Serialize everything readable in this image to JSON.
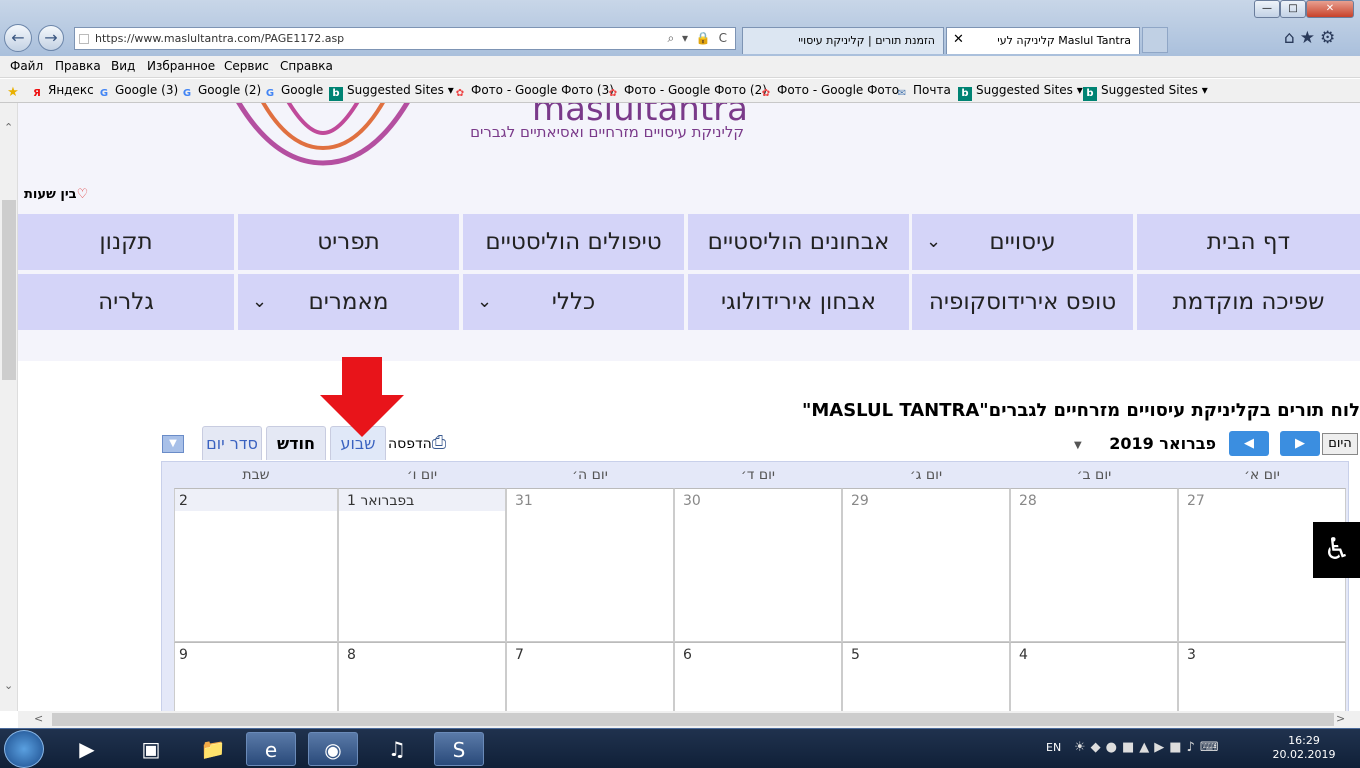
{
  "window": {
    "controls": {
      "minimize": "—",
      "maximize": "□",
      "close": "✕"
    },
    "tabs": [
      {
        "label": "הזמנת תורים | קליניקת עיסויי"
      },
      {
        "label": "Maslul Tantra קליניקה לעי",
        "close": "✕"
      }
    ],
    "toolbar_icons": [
      "home-icon",
      "star-icon",
      "gear-icon"
    ]
  },
  "address_bar": {
    "url": "https://www.maslultantra.com/PAGE1172.asp",
    "controls": "⌕ ▾ 🔒 C"
  },
  "menu": [
    "Файл",
    "Правка",
    "Вид",
    "Избранное",
    "Сервис",
    "Справка"
  ],
  "favorites": [
    {
      "label": "Яндекс",
      "icon": "Я",
      "kind": "y"
    },
    {
      "label": "Google (3)",
      "icon": "G",
      "kind": "g"
    },
    {
      "label": "Google (2)",
      "icon": "G",
      "kind": "g"
    },
    {
      "label": "Google",
      "icon": "G",
      "kind": "g"
    },
    {
      "label": "Suggested Sites ▾",
      "icon": "b",
      "kind": "b"
    },
    {
      "label": "Фото - Google Фото (3)",
      "icon": "✿",
      "kind": "p"
    },
    {
      "label": "Фото - Google Фото (2)",
      "icon": "✿",
      "kind": "p"
    },
    {
      "label": "Фото - Google Фото",
      "icon": "✿",
      "kind": "p"
    },
    {
      "label": "Почта",
      "icon": "✉",
      "kind": "m"
    },
    {
      "label": "Suggested Sites ▾",
      "icon": "b",
      "kind": "b"
    },
    {
      "label": "Suggested Sites ▾",
      "icon": "b",
      "kind": "b"
    }
  ],
  "site": {
    "logo_text": "maslultantra",
    "slogan": "קליניקת עיסויים מזרחיים ואסיאתיים לגברים",
    "hours_label": "בין שעות"
  },
  "nav": {
    "row1": [
      "דף הבית",
      "עיסויים",
      "אבחונים הוליסטיים",
      "טיפולים הוליסטיים",
      "תפריט",
      "תקנון"
    ],
    "row2": [
      "שפיכה מוקדמת",
      "טופס אירידוסקופיה",
      "אבחון אירידולוגי",
      "כללי",
      "מאמרים",
      "גלריה"
    ],
    "chevron": "⌄"
  },
  "calendar": {
    "title": "לוח תורים בקליניקת עיסויים מזרחיים לגברים\"MASLUL TANTRA\"",
    "print_label": "הדפסה",
    "views": {
      "week": "שבוע",
      "month": "חודש",
      "agenda": "סדר יום"
    },
    "today_label": "היום",
    "month_label": "פברואר 2019",
    "days": [
      "יום א׳",
      "יום ב׳",
      "יום ג׳",
      "יום ד׳",
      "יום ה׳",
      "יום ו׳",
      "שבת"
    ],
    "weeks": [
      [
        "27",
        "28",
        "29",
        "30",
        "31",
        "1 בפברואר",
        "2"
      ],
      [
        "3",
        "4",
        "5",
        "6",
        "7",
        "8",
        "9"
      ]
    ],
    "nav_prev": "◀",
    "nav_next": "▶"
  },
  "accessibility_icon": "wheelchair-icon",
  "taskbar": {
    "lang": "EN",
    "time": "16:29",
    "date": "20.02.2019",
    "apps": [
      "media-player-icon",
      "hp-icon",
      "explorer-folder-icon",
      "internet-explorer-icon",
      "chrome-icon",
      "audio-icon",
      "skype-icon"
    ]
  }
}
